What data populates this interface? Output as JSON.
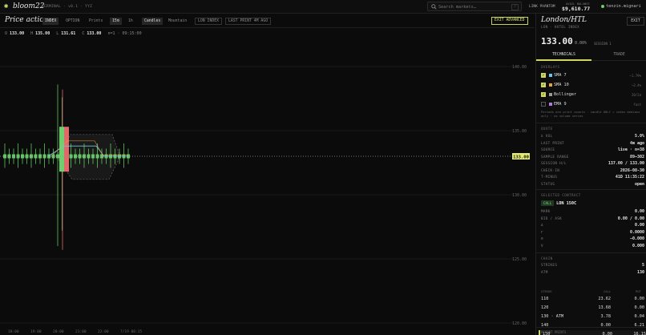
{
  "app": {
    "brand": "bloom22",
    "build": "TERMINAL · v0.1 · YYZ",
    "search_placeholder": "Search markets…",
    "search_shortcut": "/",
    "link_label": "LINK PHANTOM",
    "avail_label": "AVAIL BALANCE",
    "avail_value": "$9,610.77",
    "user": "tenzin.mignari"
  },
  "toolbar": {
    "title": "Price action",
    "modes": [
      "INDEX",
      "OPTION",
      "Prints"
    ],
    "intervals": [
      "15m",
      "1h"
    ],
    "styles": [
      "Candles",
      "Mountain"
    ],
    "tags": [
      "LON INDEX",
      "LAST PRINT 4M AGO"
    ],
    "exit_label": "EXIT ADVANCED"
  },
  "ohlc": {
    "o_label": "O",
    "o": "133.00",
    "h_label": "H",
    "h": "135.00",
    "l_label": "L",
    "l": "131.61",
    "c_label": "C",
    "c": "133.00",
    "extra": "n=1 · 09:15:00"
  },
  "chart_data": {
    "type": "candlestick",
    "y_ticks": [
      "140.00",
      "135.00",
      "130.00",
      "125.00",
      "120.00"
    ],
    "y_range": [
      120,
      142
    ],
    "x_ticks": [
      "18:00",
      "19:00",
      "20:00",
      "21:00",
      "22:00",
      "7/19 00:15"
    ],
    "last_price_label": "133.00",
    "last_price": 133.0,
    "series": [
      {
        "name": "SMA 7",
        "color": "#6fc3e8"
      },
      {
        "name": "SMA 10",
        "color": "#e8a04a"
      },
      {
        "name": "Bollinger",
        "color": "#888888"
      }
    ]
  },
  "panel": {
    "symbol": "London/HTL",
    "symbol_sub": "LON · HOTEL INDEX",
    "exit_label": "EXIT",
    "price": "133.00",
    "change": "0.00%",
    "session": "SESSION 1",
    "tabs": [
      "TECHNICALS",
      "TRADE"
    ],
    "overlays_label": "OVERLAYS",
    "overlays": [
      {
        "name": "SMA 7",
        "value": "~1.79%",
        "on": true,
        "color": "#6fc3e8"
      },
      {
        "name": "SMA 10",
        "value": "~2.4%",
        "on": true,
        "color": "#e8a04a"
      },
      {
        "name": "Bollinger",
        "value": "20/2σ",
        "on": true,
        "color": "#9a9a9a"
      },
      {
        "name": "EMA 9",
        "value": "fast",
        "on": false,
        "color": "#b07ae0"
      }
    ],
    "overlay_note": "Periods are print counts · candle OHLC = index medians only · no volume series",
    "quote_label": "QUOTE",
    "quote": [
      {
        "k": "Σ VOL",
        "v": "5.0%"
      },
      {
        "k": "LAST PRINT",
        "v": "4m ago"
      },
      {
        "k": "SOURCE",
        "v": "live · n=38"
      },
      {
        "k": "SAMPLE RANGE",
        "v": "89–302"
      },
      {
        "k": "SESSION H/L",
        "v": "137.00 / 133.00"
      },
      {
        "k": "CHECK-IN",
        "v": "2026-08-30"
      },
      {
        "k": "T-MINUS",
        "v": "41D 11:35:22"
      },
      {
        "k": "STATUS",
        "v": "open"
      }
    ],
    "contract_label": "SELECTED CONTRACT",
    "contract_tag": "CALL",
    "contract_name": "LON 150C",
    "greeks": [
      {
        "k": "MARK",
        "v": "0.00"
      },
      {
        "k": "BID / ASK",
        "v": "0.00 / 0.00"
      },
      {
        "k": "Δ",
        "v": "0.00"
      },
      {
        "k": "Γ",
        "v": "0.0000"
      },
      {
        "k": "Θ",
        "v": "−0.000"
      },
      {
        "k": "V",
        "v": "0.000"
      }
    ],
    "chain_label": "CHAIN",
    "chain_meta": [
      {
        "k": "STRIKES",
        "v": "5"
      },
      {
        "k": "ATM",
        "v": "130"
      }
    ],
    "chain_head": {
      "strike": "STRIKE",
      "call": "CALL",
      "put": "PUT"
    },
    "chain_rows": [
      {
        "strike": "110",
        "call": "23.62",
        "put": "0.00"
      },
      {
        "strike": "120",
        "call": "13.68",
        "put": "0.00"
      },
      {
        "strike": "130 · ATM",
        "call": "3.78",
        "put": "0.04"
      },
      {
        "strike": "140",
        "call": "0.00",
        "put": "6.21"
      },
      {
        "strike": "150",
        "call": "0.00",
        "put": "16.15"
      }
    ],
    "recent_label": "RECENT PRINTS"
  }
}
